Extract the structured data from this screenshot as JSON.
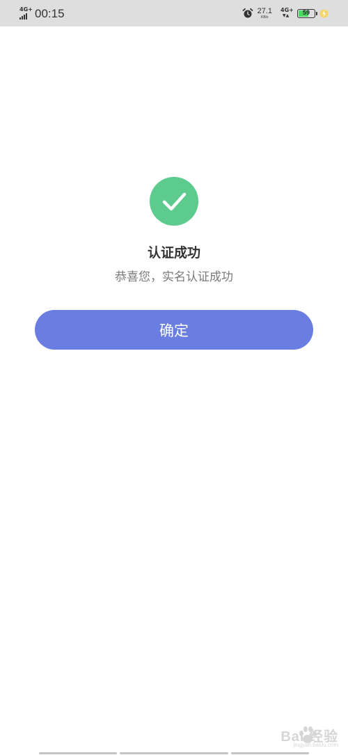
{
  "status_bar": {
    "network_left": "4G+",
    "time": "00:15",
    "speed_value": "27.1",
    "speed_unit": "KB/s",
    "network_right": "4G+",
    "battery_level": "59",
    "battery_fraction": 0.59,
    "battery_color": "#4cd964",
    "icons": [
      "signal-icon",
      "alarm-icon",
      "network-arrows-icon",
      "battery-icon",
      "charging-icon"
    ]
  },
  "main": {
    "icon": "check-circle-icon",
    "icon_color": "#5ccb8d",
    "title": "认证成功",
    "subtitle": "恭喜您，实名认证成功",
    "confirm_label": "确定",
    "button_color": "#6a7de0"
  },
  "watermark": {
    "text": "Bai 经验",
    "url": "jingyan.baidu.com"
  }
}
